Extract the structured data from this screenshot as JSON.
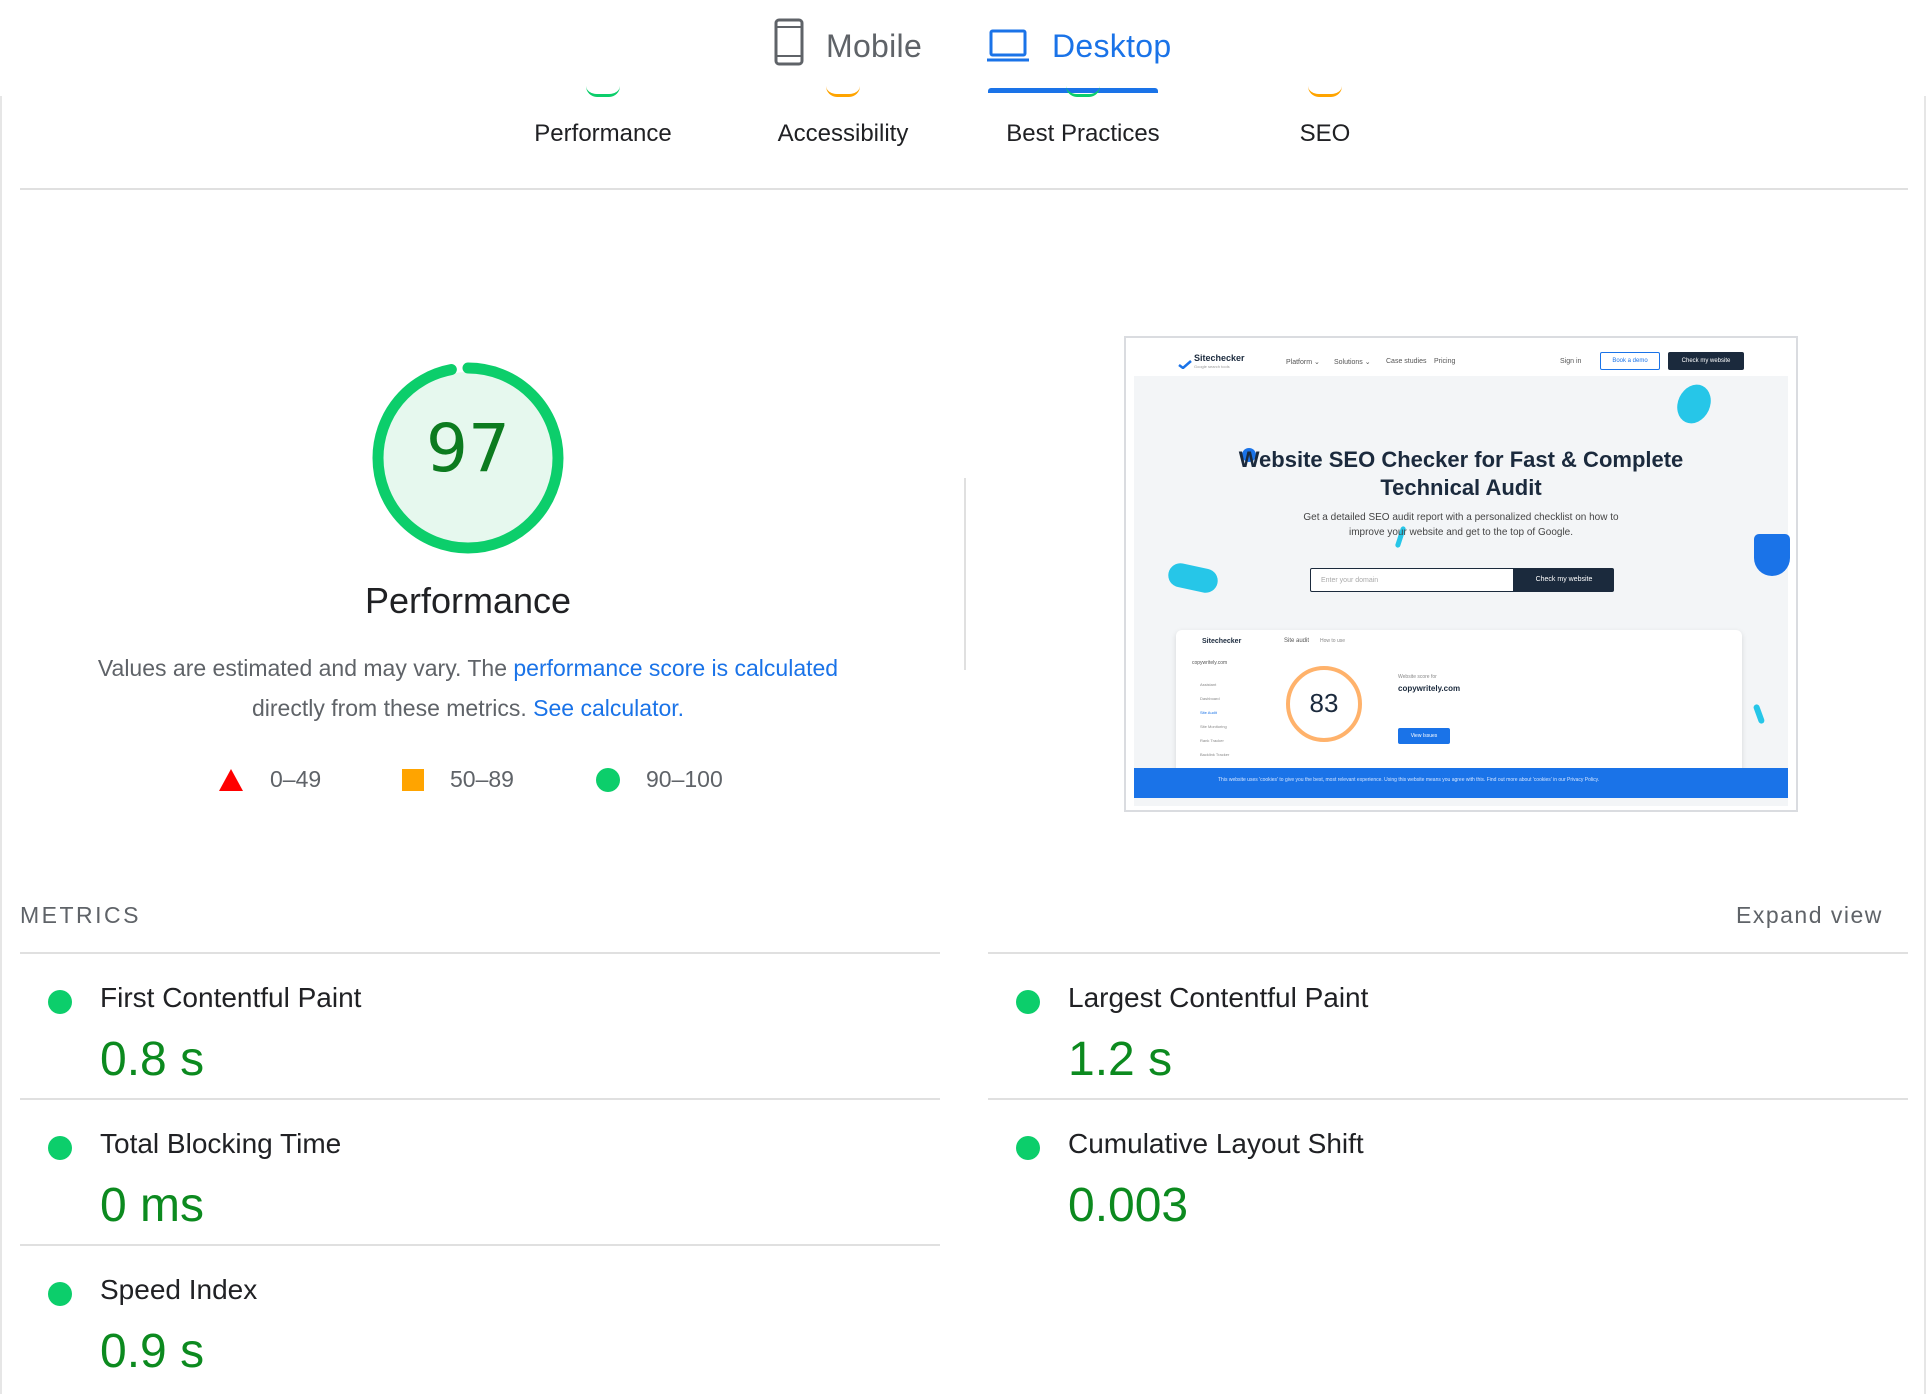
{
  "device_tabs": {
    "mobile": {
      "label": "Mobile",
      "icon": "phone-icon"
    },
    "desktop": {
      "label": "Desktop",
      "icon": "laptop-icon",
      "selected": true
    }
  },
  "categories": [
    {
      "label": "Performance",
      "color": "#0cce6b"
    },
    {
      "label": "Accessibility",
      "color": "#ffa400"
    },
    {
      "label": "Best Practices",
      "color": "#0cce6b"
    },
    {
      "label": "SEO",
      "color": "#ffa400"
    }
  ],
  "performance": {
    "score": "97",
    "score_value": 97,
    "title": "Performance",
    "description_start": "Values are estimated and may vary. The ",
    "description_link1": "performance score is calculated",
    "description_mid": "directly from these metrics. ",
    "description_link2": "See calculator."
  },
  "legend": [
    {
      "range": "0–49",
      "shape": "triangle",
      "color": "#ff0000"
    },
    {
      "range": "50–89",
      "shape": "square",
      "color": "#ffa400"
    },
    {
      "range": "90–100",
      "shape": "circle",
      "color": "#0cce6b"
    }
  ],
  "screenshot": {
    "brand": "Sitechecker",
    "brand_tagline": "Google search tools",
    "nav": [
      "Platform ⌄",
      "Solutions ⌄",
      "Case studies",
      "Pricing"
    ],
    "sign_in": "Sign in",
    "book_demo": "Book a demo",
    "check_website": "Check my website",
    "hero_title_line1": "Website SEO Checker for Fast & Complete",
    "hero_title_line2": "Technical Audit",
    "hero_sub_line1": "Get a detailed SEO audit report with a personalized checklist on how to",
    "hero_sub_line2": "improve your website and get to the top of Google.",
    "input_placeholder": "Enter your domain",
    "cta": "Check my website",
    "dash_brand": "Sitechecker",
    "dash_tab": "Site audit",
    "dash_howto": "How to use",
    "dash_site": "copywritely.com",
    "dash_score": "83",
    "dash_score_for": "Website score for",
    "dash_domain": "copywritely.com",
    "dash_btn": "View Issues",
    "dash_menu": [
      "Assistant",
      "Dashboard",
      "Site Audit",
      "Site Monitoring",
      "Rank Tracker",
      "Backlink Tracker"
    ],
    "cookie": "This website uses 'cookies' to give you the best, most relevant experience. Using this website means you agree with this. Find out more about 'cookies' in our Privacy Policy."
  },
  "metrics": {
    "label": "METRICS",
    "expand": "Expand view",
    "items": [
      {
        "name": "First Contentful Paint",
        "value": "0.8 s"
      },
      {
        "name": "Largest Contentful Paint",
        "value": "1.2 s"
      },
      {
        "name": "Total Blocking Time",
        "value": "0 ms"
      },
      {
        "name": "Cumulative Layout Shift",
        "value": "0.003"
      },
      {
        "name": "Speed Index",
        "value": "0.9 s"
      }
    ]
  }
}
